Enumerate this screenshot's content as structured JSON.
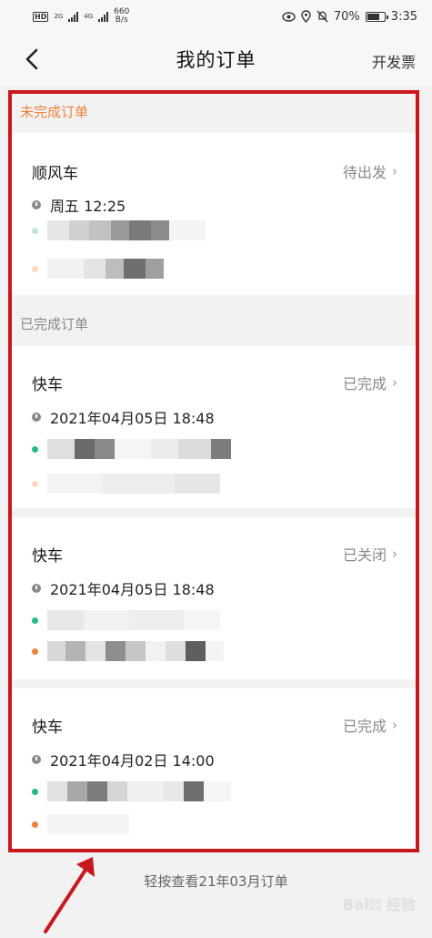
{
  "status_bar": {
    "hd_badge": "HD",
    "network_1": "2G",
    "network_2": "4G",
    "speed_value": "660",
    "speed_unit": "B/s",
    "battery": "70%",
    "time": "3:35"
  },
  "nav": {
    "title": "我的订单",
    "invoice_label": "开发票"
  },
  "sections": {
    "pending_label": "未完成订单",
    "completed_label": "已完成订单"
  },
  "orders": [
    {
      "type": "顺风车",
      "status": "待出发",
      "time": "周五 12:25"
    },
    {
      "type": "快车",
      "status": "已完成",
      "time": "2021年04月05日 18:48"
    },
    {
      "type": "快车",
      "status": "已关闭",
      "time": "2021年04月05日 18:48"
    },
    {
      "type": "快车",
      "status": "已完成",
      "time": "2021年04月02日 14:00"
    }
  ],
  "footer": {
    "hint": "轻按查看21年03月订单"
  },
  "colors": {
    "pending_accent": "#f0823c",
    "start_dot": "#27b88a",
    "end_dot": "#f0823c",
    "highlight_frame": "#c8181e"
  },
  "icons": {
    "back": "chevron-left-icon",
    "status_chevron": "chevron-right-icon",
    "clock": "clock-icon"
  }
}
